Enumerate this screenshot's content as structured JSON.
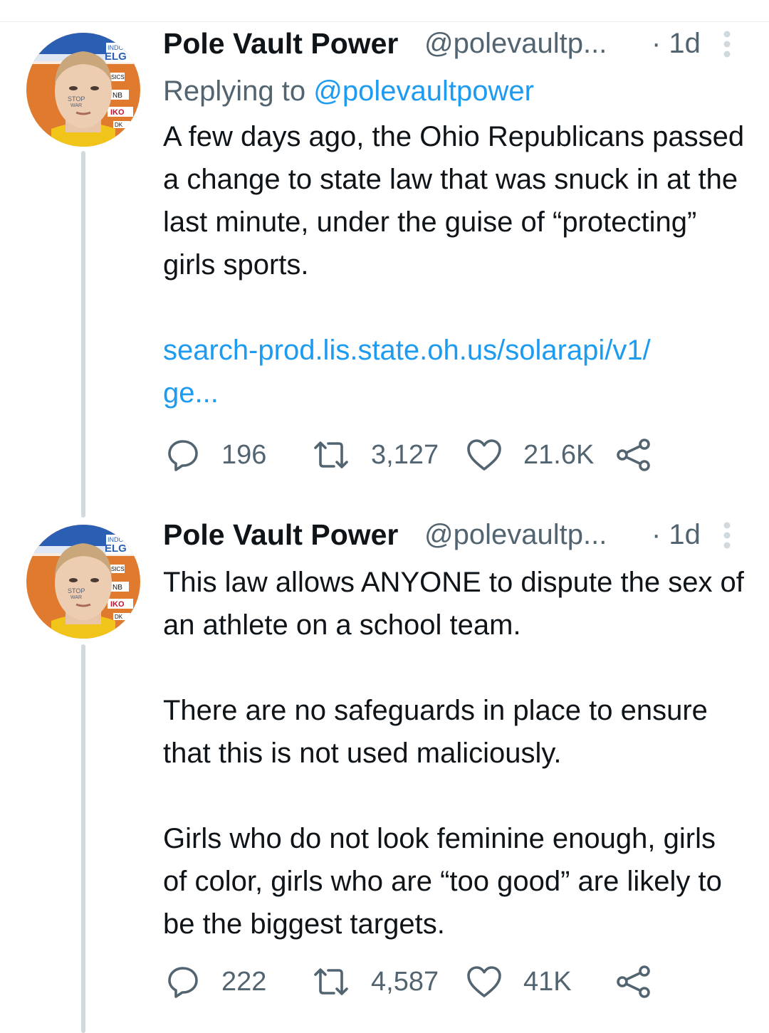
{
  "tweets": [
    {
      "name": "Pole Vault Power",
      "handle": "@polevaultp...",
      "time": "· 1d",
      "replying_label": "Replying to ",
      "replying_to": "@polevaultpower",
      "text": "A few days ago, the Ohio Republicans passed a change to state law that was snuck in at the last minute, under the guise of “protecting” girls sports.",
      "link_line1": "search-prod.lis.state.oh.us/solarapi/v1/",
      "link_line2": "ge...",
      "replies": "196",
      "retweets": "3,127",
      "likes": "21.6K"
    },
    {
      "name": "Pole Vault Power",
      "handle": "@polevaultp...",
      "time": "· 1d",
      "paragraphs": [
        "This law allows ANYONE to dispute the sex of an athlete on a school team.",
        "There are no safeguards in place to ensure that this is not used maliciously.",
        "Girls who do not look feminine enough, girls of color, girls who are “too good” are likely to be the biggest targets."
      ],
      "replies": "222",
      "retweets": "4,587",
      "likes": "41K"
    }
  ],
  "avatar_overlay_text": [
    "INDOOR",
    "ELG",
    "SICS",
    "NB",
    "IKO",
    "STOP",
    "WAR",
    "DK"
  ],
  "icons": {
    "reply": "reply-icon",
    "retweet": "retweet-icon",
    "like": "heart-icon",
    "share": "share-icon",
    "more": "more-vertical-icon"
  },
  "colors": {
    "link": "#1d9bf0",
    "secondary_text": "#536471",
    "primary_text": "#0f1419",
    "thread_line": "#cfd9de",
    "avatar_bg": "#e07a2e",
    "avatar_jersey": "#f0c419"
  }
}
